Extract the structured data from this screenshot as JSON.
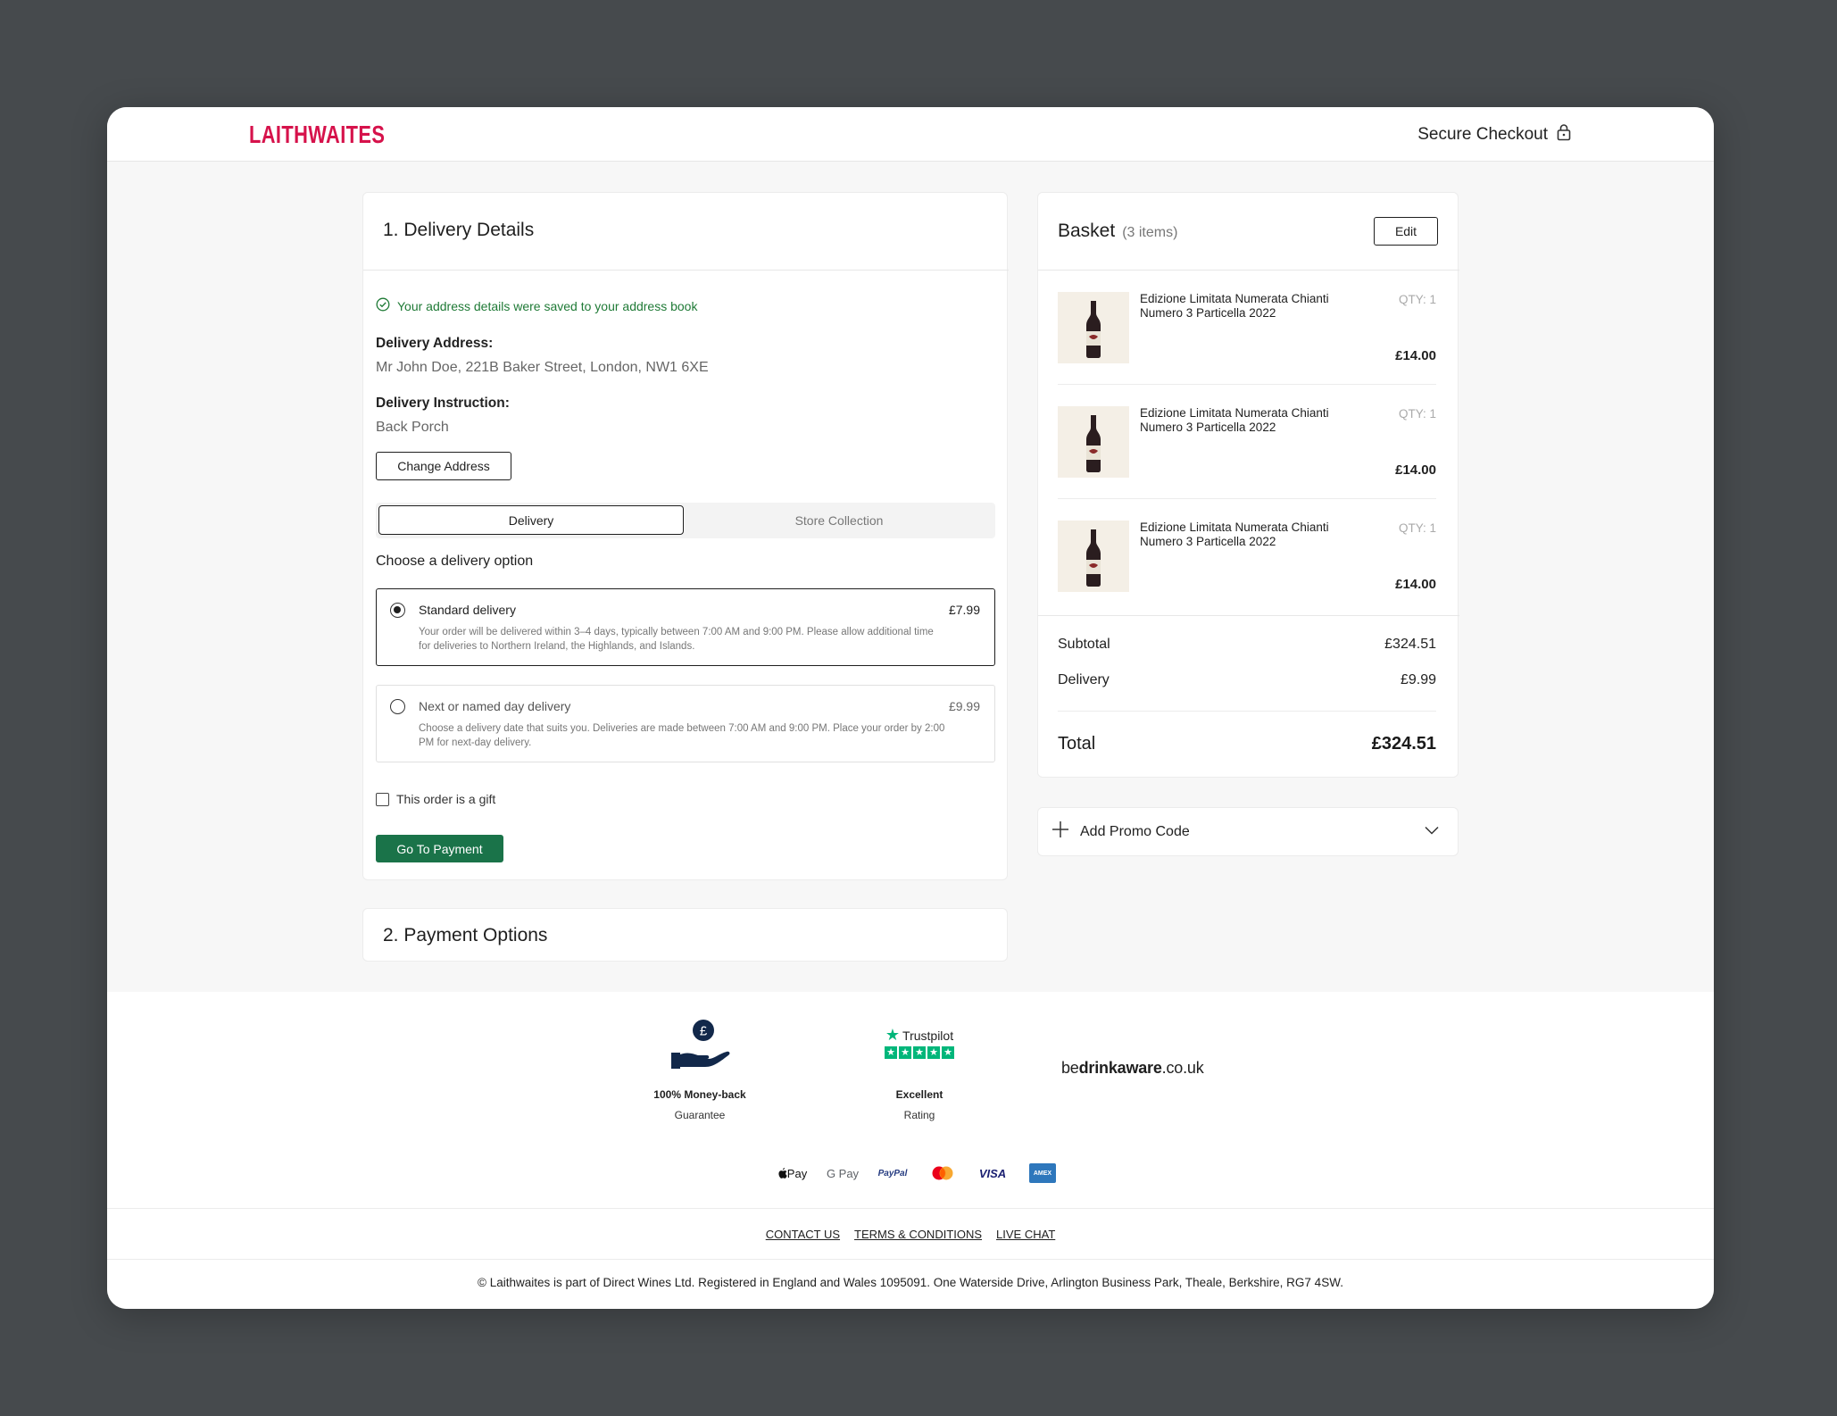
{
  "header": {
    "logo": "LAITHWAITES",
    "secure_label": "Secure Checkout"
  },
  "delivery": {
    "title": "1. Delivery Details",
    "saved_message": "Your address details were saved to your address book",
    "address_label": "Delivery Address:",
    "address_value": "Mr John Doe, 221B Baker Street, London, NW1 6XE",
    "instruction_label": "Delivery Instruction:",
    "instruction_value": "Back Porch",
    "change_address": "Change Address",
    "tabs": [
      "Delivery",
      "Store Collection"
    ],
    "choose_label": "Choose a delivery option",
    "options": [
      {
        "title": "Standard delivery",
        "price": "£7.99",
        "description": "Your order will be delivered within 3–4 days, typically between 7:00 AM and 9:00 PM. Please allow additional time for deliveries to Northern Ireland, the Highlands, and Islands.",
        "selected": true
      },
      {
        "title": "Next or named day delivery",
        "price": "£9.99",
        "description": "Choose a delivery date that suits you. Deliveries are made between 7:00 AM and 9:00 PM. Place your order by 2:00 PM for next-day delivery.",
        "selected": false
      }
    ],
    "gift_label": "This order is a gift",
    "go_to_payment": "Go To Payment"
  },
  "payment": {
    "title": "2. Payment Options"
  },
  "basket": {
    "title": "Basket",
    "count": "(3 items)",
    "edit": "Edit",
    "items": [
      {
        "name": "Edizione Limitata Numerata Chianti Numero 3 Particella 2022",
        "qty": "QTY: 1",
        "price": "£14.00"
      },
      {
        "name": "Edizione Limitata Numerata Chianti Numero 3 Particella 2022",
        "qty": "QTY: 1",
        "price": "£14.00"
      },
      {
        "name": "Edizione Limitata Numerata Chianti Numero 3 Particella 2022",
        "qty": "QTY: 1",
        "price": "£14.00"
      }
    ],
    "subtotal_label": "Subtotal",
    "subtotal_value": "£324.51",
    "delivery_label": "Delivery",
    "delivery_value": "£9.99",
    "total_label": "Total",
    "total_value": "£324.51"
  },
  "promo": {
    "label": "Add Promo Code"
  },
  "footer": {
    "money_back_1": "100% Money-back",
    "money_back_2": "Guarantee",
    "trustpilot_brand": "Trustpilot",
    "trustpilot_1": "Excellent",
    "trustpilot_2": "Rating",
    "drinkaware_pre": "be",
    "drinkaware_bold": "drinkaware",
    "drinkaware_post": ".co.uk",
    "payment_methods": [
      "Pay",
      "G Pay",
      "PayPal",
      "",
      "VISA",
      "AMEX"
    ],
    "links": [
      "CONTACT US",
      "TERMS & CONDITIONS",
      "LIVE CHAT"
    ],
    "copyright": "© Laithwaites is part of Direct Wines Ltd. Registered in England and Wales 1095091. One Waterside Drive, Arlington Business Park, Theale, Berkshire, RG7 4SW."
  },
  "colors": {
    "brand": "#d6124b",
    "primary_button": "#1a7349",
    "success_text": "#1f7a36",
    "trustpilot_green": "#00b67a",
    "icon_navy": "#12284a"
  }
}
